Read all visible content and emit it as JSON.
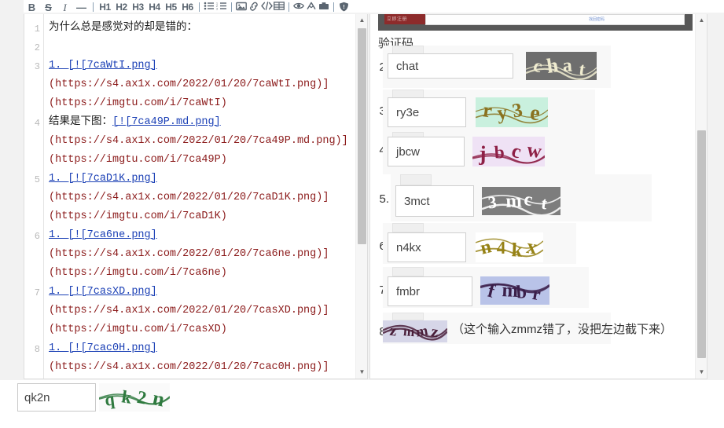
{
  "toolbar": {
    "groups": [
      {
        "items": [
          {
            "name": "bold-button",
            "label": "B",
            "kind": "text",
            "style": "bold"
          },
          {
            "name": "strikethrough-button",
            "label": "S",
            "kind": "text",
            "style": "strike"
          },
          {
            "name": "italic-button",
            "label": "I",
            "kind": "text",
            "style": "ital"
          },
          {
            "name": "horizontal-rule-button",
            "label": "—",
            "kind": "text",
            "style": "rule"
          }
        ]
      },
      {
        "items": [
          {
            "name": "heading-1-button",
            "label": "H1",
            "kind": "text",
            "style": "head"
          },
          {
            "name": "heading-2-button",
            "label": "H2",
            "kind": "text",
            "style": "head"
          },
          {
            "name": "heading-3-button",
            "label": "H3",
            "kind": "text",
            "style": "head"
          },
          {
            "name": "heading-4-button",
            "label": "H4",
            "kind": "text",
            "style": "head"
          },
          {
            "name": "heading-5-button",
            "label": "H5",
            "kind": "text",
            "style": "head"
          },
          {
            "name": "heading-6-button",
            "label": "H6",
            "kind": "text",
            "style": "head"
          }
        ]
      },
      {
        "items": [
          {
            "name": "unordered-list-icon",
            "label": "",
            "kind": "icon",
            "glyph": "ul"
          },
          {
            "name": "ordered-list-icon",
            "label": "",
            "kind": "icon",
            "glyph": "ol"
          }
        ]
      },
      {
        "items": [
          {
            "name": "image-icon",
            "label": "",
            "kind": "icon",
            "glyph": "image"
          },
          {
            "name": "link-icon",
            "label": "",
            "kind": "icon",
            "glyph": "link"
          },
          {
            "name": "code-icon",
            "label": "",
            "kind": "icon",
            "glyph": "code"
          },
          {
            "name": "table-icon",
            "label": "",
            "kind": "icon",
            "glyph": "table"
          }
        ]
      },
      {
        "items": [
          {
            "name": "preview-eye-icon",
            "label": "",
            "kind": "icon",
            "glyph": "eye"
          },
          {
            "name": "fullscreen-icon",
            "label": "",
            "kind": "icon",
            "glyph": "expand"
          },
          {
            "name": "save-icon",
            "label": "",
            "kind": "icon",
            "glyph": "save"
          }
        ]
      },
      {
        "items": [
          {
            "name": "info-icon",
            "label": "",
            "kind": "icon",
            "glyph": "info"
          }
        ]
      }
    ]
  },
  "editor": {
    "lines": [
      {
        "no": "1",
        "segments": [
          {
            "t": "为什么总是感觉对的却是错的：",
            "c": "plain"
          }
        ]
      },
      {
        "no": "2",
        "segments": []
      },
      {
        "no": "3",
        "segments": [
          {
            "t": "1. ",
            "c": "link"
          },
          {
            "t": "[!",
            "c": "link"
          },
          {
            "t": "[7caWtI.png]",
            "c": "link"
          }
        ]
      },
      {
        "no": "",
        "segments": [
          {
            "t": "(https://s4.ax1x.com/2022/01/20/7caWtI.png)]",
            "c": "url"
          }
        ]
      },
      {
        "no": "",
        "segments": [
          {
            "t": "(https://imgtu.com/i/7caWtI)",
            "c": "url"
          }
        ]
      },
      {
        "no": "4",
        "segments": [
          {
            "t": "结果是下图：",
            "c": "plain"
          },
          {
            "t": "[!",
            "c": "link"
          },
          {
            "t": "[7ca49P.md.png]",
            "c": "link"
          }
        ]
      },
      {
        "no": "",
        "segments": [
          {
            "t": "(https://s4.ax1x.com/2022/01/20/7ca49P.md.png)]",
            "c": "url"
          }
        ]
      },
      {
        "no": "",
        "segments": [
          {
            "t": "(https://imgtu.com/i/7ca49P)",
            "c": "url"
          }
        ]
      },
      {
        "no": "5",
        "segments": [
          {
            "t": "1. ",
            "c": "link"
          },
          {
            "t": "[!",
            "c": "link"
          },
          {
            "t": "[7caD1K.png]",
            "c": "link"
          }
        ]
      },
      {
        "no": "",
        "segments": [
          {
            "t": "(https://s4.ax1x.com/2022/01/20/7caD1K.png)]",
            "c": "url"
          }
        ]
      },
      {
        "no": "",
        "segments": [
          {
            "t": "(https://imgtu.com/i/7caD1K)",
            "c": "url"
          }
        ]
      },
      {
        "no": "6",
        "segments": [
          {
            "t": "1. ",
            "c": "link"
          },
          {
            "t": "[!",
            "c": "link"
          },
          {
            "t": "[7ca6ne.png]",
            "c": "link"
          }
        ]
      },
      {
        "no": "",
        "segments": [
          {
            "t": "(https://s4.ax1x.com/2022/01/20/7ca6ne.png)]",
            "c": "url"
          }
        ]
      },
      {
        "no": "",
        "segments": [
          {
            "t": "(https://imgtu.com/i/7ca6ne)",
            "c": "url"
          }
        ]
      },
      {
        "no": "7",
        "segments": [
          {
            "t": "1. ",
            "c": "link"
          },
          {
            "t": "[!",
            "c": "link"
          },
          {
            "t": "[7casXD.png]",
            "c": "link"
          }
        ]
      },
      {
        "no": "",
        "segments": [
          {
            "t": "(https://s4.ax1x.com/2022/01/20/7casXD.png)]",
            "c": "url"
          }
        ]
      },
      {
        "no": "",
        "segments": [
          {
            "t": "(https://imgtu.com/i/7casXD)",
            "c": "url"
          }
        ]
      },
      {
        "no": "8",
        "segments": [
          {
            "t": "1. ",
            "c": "link"
          },
          {
            "t": "[!",
            "c": "link"
          },
          {
            "t": "[7cac0H.png]",
            "c": "link"
          }
        ]
      },
      {
        "no": "",
        "segments": [
          {
            "t": "(https://s4.ax1x.com/2022/01/20/7cac0H.png)]",
            "c": "url"
          }
        ]
      }
    ]
  },
  "preview": {
    "top_shot": {
      "red_button_text": "立即注册",
      "blue_link_text": "找回密码"
    },
    "section_label": "验证码",
    "items": [
      {
        "num": "2.",
        "input": "chat",
        "captcha_text": "chat",
        "captcha_bg": "#6e6e6e",
        "captcha_fg": "#f0ecd0"
      },
      {
        "num": "3.",
        "input": "ry3e",
        "captcha_text": "ry3e",
        "captcha_bg": "#c9f0de",
        "captcha_fg": "#8a7220"
      },
      {
        "num": "4.",
        "input": "jbcw",
        "captcha_text": "jbcw",
        "captcha_bg": "#efe2f5",
        "captcha_fg": "#8e2046"
      },
      {
        "num": "5.",
        "input": "3mct",
        "captcha_text": "3mct",
        "captcha_bg": "#7d7d7d",
        "captcha_fg": "#ffffff"
      },
      {
        "num": "6.",
        "input": "n4kx",
        "captcha_text": "n4kx",
        "captcha_bg": "#ffffff",
        "captcha_fg": "#968216"
      },
      {
        "num": "7.",
        "input": "fmbr",
        "captcha_text": "fmbr",
        "captcha_bg": "#b9c3e8",
        "captcha_fg": "#3b1f4a"
      },
      {
        "num": "8.",
        "input": "",
        "captcha_text": "zmmz",
        "captcha_bg": "#d6d6e8",
        "captcha_fg": "#4a1f3a"
      }
    ],
    "note": "（这个输入zmmz错了，没把左边截下来）"
  },
  "bottom": {
    "input_value": "qk2n",
    "captcha_text": "qk2n",
    "captcha_color": "#2f7a3f"
  }
}
